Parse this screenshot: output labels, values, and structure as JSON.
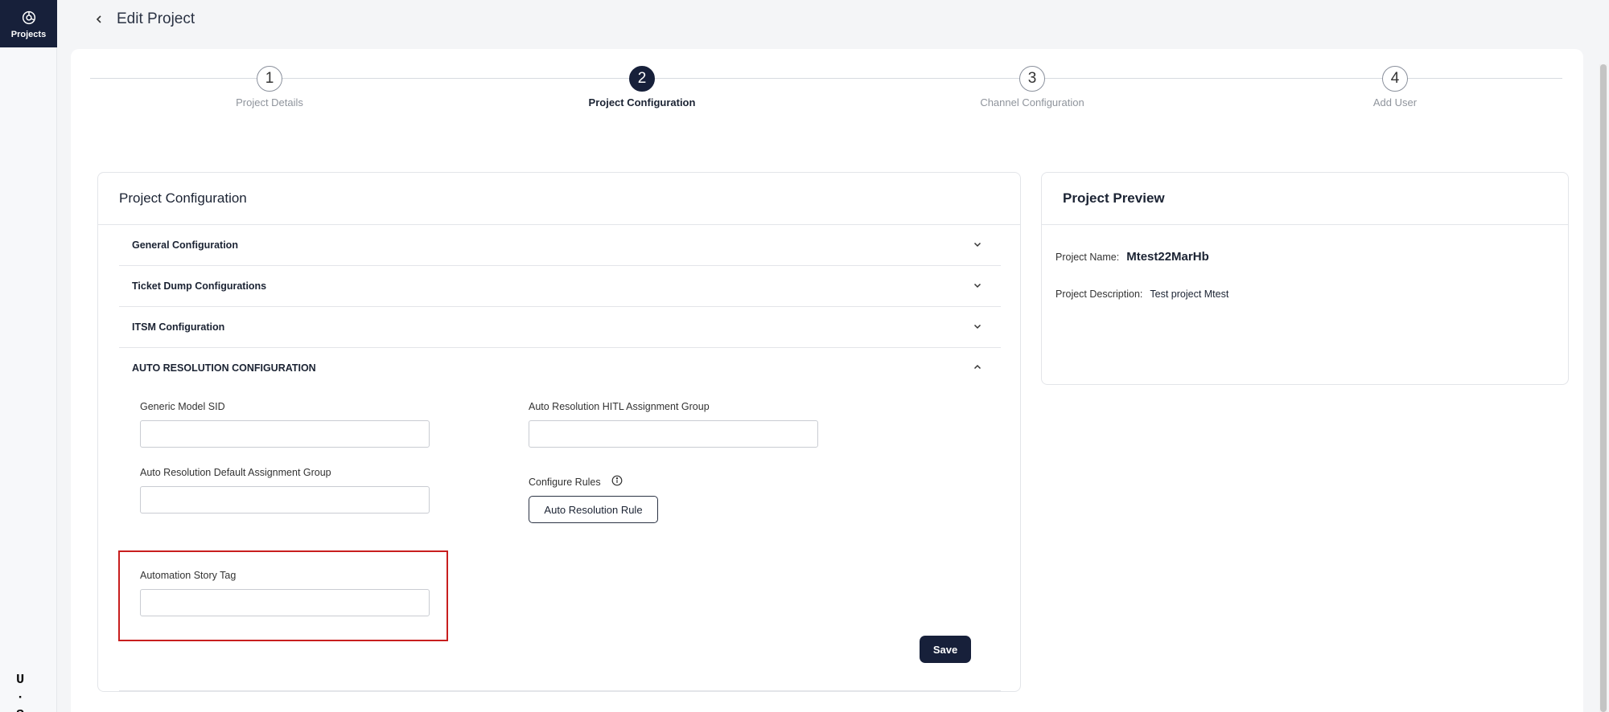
{
  "sidebar": {
    "projects_label": "Projects",
    "logo_line1": "U ·",
    "logo_line2": "S T"
  },
  "header": {
    "title": "Edit Project"
  },
  "stepper": {
    "steps": [
      {
        "number": "1",
        "label": "Project Details"
      },
      {
        "number": "2",
        "label": "Project Configuration"
      },
      {
        "number": "3",
        "label": "Channel Configuration"
      },
      {
        "number": "4",
        "label": "Add User"
      }
    ],
    "active_step": 2
  },
  "config": {
    "title": "Project Configuration",
    "sections": [
      {
        "label": "General Configuration",
        "expanded": false
      },
      {
        "label": "Ticket Dump Configurations",
        "expanded": false
      },
      {
        "label": "ITSM Configuration",
        "expanded": false
      },
      {
        "label": "AUTO RESOLUTION CONFIGURATION",
        "expanded": true
      }
    ],
    "auto_resolution": {
      "generic_model_sid_label": "Generic Model SID",
      "generic_model_sid_value": "",
      "hitl_group_label": "Auto Resolution HITL Assignment Group",
      "hitl_group_value": "",
      "default_group_label": "Auto Resolution Default Assignment Group",
      "default_group_value": "",
      "configure_rules_label": "Configure Rules",
      "rule_button_label": "Auto Resolution Rule",
      "story_tag_label": "Automation Story Tag",
      "story_tag_value": ""
    },
    "save_label": "Save"
  },
  "preview": {
    "title": "Project Preview",
    "name_label": "Project Name:",
    "name_value": "Mtest22MarHb",
    "description_label": "Project Description:",
    "description_value": "Test project Mtest"
  },
  "colors": {
    "primary": "#17203a",
    "highlight": "#c81e1e",
    "border": "#e3e5e9"
  }
}
